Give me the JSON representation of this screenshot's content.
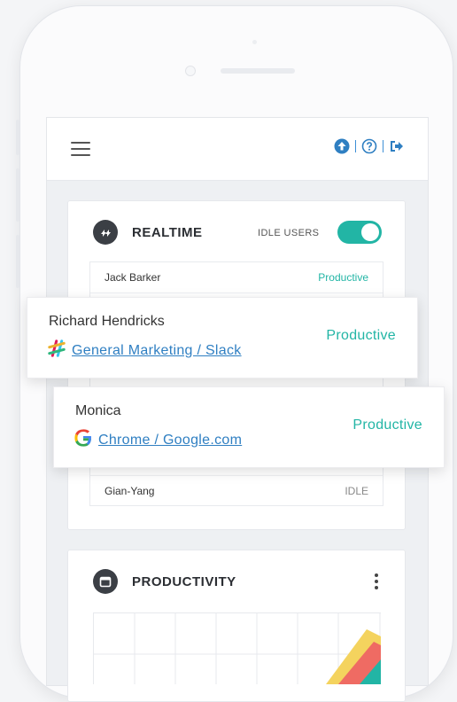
{
  "topbar": {
    "icons": [
      "upload-icon",
      "help-icon",
      "logout-icon"
    ]
  },
  "realtime": {
    "title": "REALTIME",
    "idle_users_label": "IDLE USERS",
    "idle_users_on": true,
    "rows": [
      {
        "name": "Jack Barker",
        "status": "Productive"
      },
      {
        "name": "Gian-Yang",
        "status": "IDLE"
      }
    ]
  },
  "popups": [
    {
      "name": "Richard Hendricks",
      "activity": "General Marketing / Slack",
      "status": "Productive",
      "icon": "slack-icon"
    },
    {
      "name": "Monica",
      "activity": "Chrome / Google.com",
      "status": "Productive",
      "icon": "google-icon"
    }
  ],
  "productivity": {
    "title": "PRODUCTIVITY",
    "menu_icon": "kebab-menu-icon"
  },
  "colors": {
    "accent": "#22b5a5",
    "link": "#2f7fc2",
    "dark": "#3b3f45"
  }
}
